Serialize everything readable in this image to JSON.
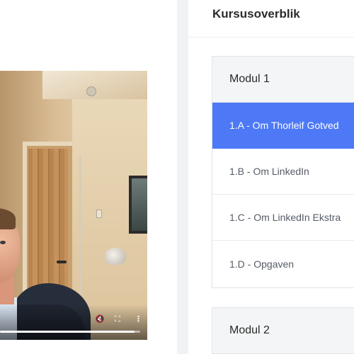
{
  "panel": {
    "title": "Kursusoverblik"
  },
  "modules": [
    {
      "name": "Modul 1",
      "lessons": [
        {
          "label": "1.A - Om Thorleif Gotved",
          "active": true
        },
        {
          "label": "1.B - Om LinkedIn",
          "active": false
        },
        {
          "label": "1.C - Om LinkedIn Ekstra",
          "active": false
        },
        {
          "label": "1.D - Opgaven",
          "active": false
        }
      ]
    },
    {
      "name": "Modul 2",
      "lessons": []
    }
  ],
  "video": {
    "progress": 0.96,
    "icons": {
      "mute": "mute-icon",
      "fullscreen": "fullscreen-icon",
      "more": "more-vertical-icon"
    }
  },
  "colors": {
    "accent": "#4d79f6",
    "gutter": "#f1f2f6",
    "module_header_bg": "#f4f5f7"
  }
}
